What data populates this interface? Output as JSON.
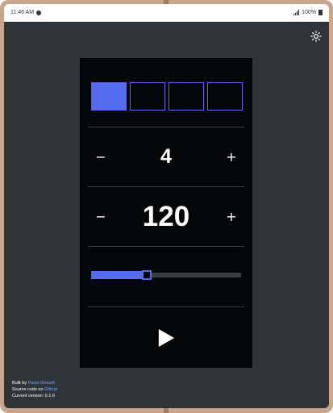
{
  "statusbar": {
    "time": "11:46 AM",
    "battery": "100%"
  },
  "theme_toggle": {
    "icon": "sun-icon",
    "glyph": "☼"
  },
  "beats": {
    "active_index": 0,
    "count": 4
  },
  "beats_counter": {
    "minus_label": "−",
    "value": "4",
    "plus_label": "+"
  },
  "tempo_counter": {
    "minus_label": "−",
    "value": "120",
    "plus_label": "+"
  },
  "slider": {
    "value_fraction": 0.36
  },
  "play": {
    "icon": "play-icon"
  },
  "footer": {
    "built_by_prefix": "Built by ",
    "author": "Paolo Giraudi",
    "source_prefix": "Source code on ",
    "source_link": "Github",
    "version_label": "Current version: 0.1.6"
  },
  "colors": {
    "accent": "#566cf0",
    "background": "#2f3439",
    "panel": "#050608",
    "link": "#7fa7ff"
  }
}
